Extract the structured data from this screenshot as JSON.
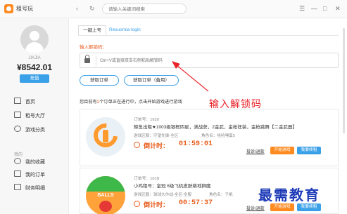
{
  "window": {
    "app_title": "租号玩",
    "search_placeholder": "请输入关键词搜索",
    "nav_back": "‹",
    "nav_refresh": "↻",
    "controls": [
      "☰",
      "—",
      "□",
      "✕"
    ]
  },
  "sidebar": {
    "username": "JIAJIA",
    "balance": "¥8542.01",
    "recharge_label": "充值",
    "section_label": "我的",
    "items": [
      {
        "label": "首页",
        "icon": "home-icon"
      },
      {
        "label": "租号大厅",
        "icon": "hall-icon"
      },
      {
        "label": "游戏分类",
        "icon": "category-icon"
      },
      {
        "label": "我的收藏",
        "icon": "favorite-icon"
      },
      {
        "label": "我的订单",
        "icon": "order-icon"
      },
      {
        "label": "财务明细",
        "icon": "finance-icon"
      }
    ]
  },
  "main": {
    "tabs": [
      {
        "label": "一键上号",
        "active": true
      },
      {
        "label": "Resuomia login",
        "active": false
      }
    ],
    "unlock_label": "输入解锁码：",
    "unlock_placeholder": "Ctrl+V或直接双击右侧粘贴解锁码",
    "buttons": {
      "get_order": "获取订单",
      "get_order_backup": "获取订单（备用）"
    },
    "notice_pre": "您目前有",
    "notice_count": "2",
    "notice_post": "个订单正在进行中，点击开始游戏进行游戏",
    "orders": [
      {
        "order_no": "订单号：1620",
        "title": "鲸鱼出租★1003级银框四星，满战获，2金武，金枪狂装，金枪跳舞【二金武器】",
        "region": "游戏区服：守望先锋-全区",
        "role": "角色名：哈哈嘿莫5",
        "timer_label": "倒计时：",
        "timer": "01:59:01",
        "complain_label": "投诉/退款",
        "start_label": "开始游戏",
        "renew_label": "我要续租"
      },
      {
        "order_no": "订单号：1618",
        "title": "小鸡租号：皇冠 6级飞机皮肤络地狮魔",
        "region": "游戏区服：球球大作战-全区-全服",
        "role": "角色名：子帆",
        "timer_label": "倒计时：",
        "timer": "00:57:37",
        "complain_label": "投诉/退款",
        "start_label": "开始游戏",
        "renew_label": "我要续租"
      }
    ]
  },
  "overlay": {
    "annotation": "输入解锁码",
    "watermark": "最需教育"
  },
  "colors": {
    "accent_blue": "#3aa0e8",
    "accent_orange": "#ff8a1f",
    "alert_red": "#e85a1a",
    "annotation_red": "#e8232a",
    "watermark_blue": "#1f3cb8"
  }
}
